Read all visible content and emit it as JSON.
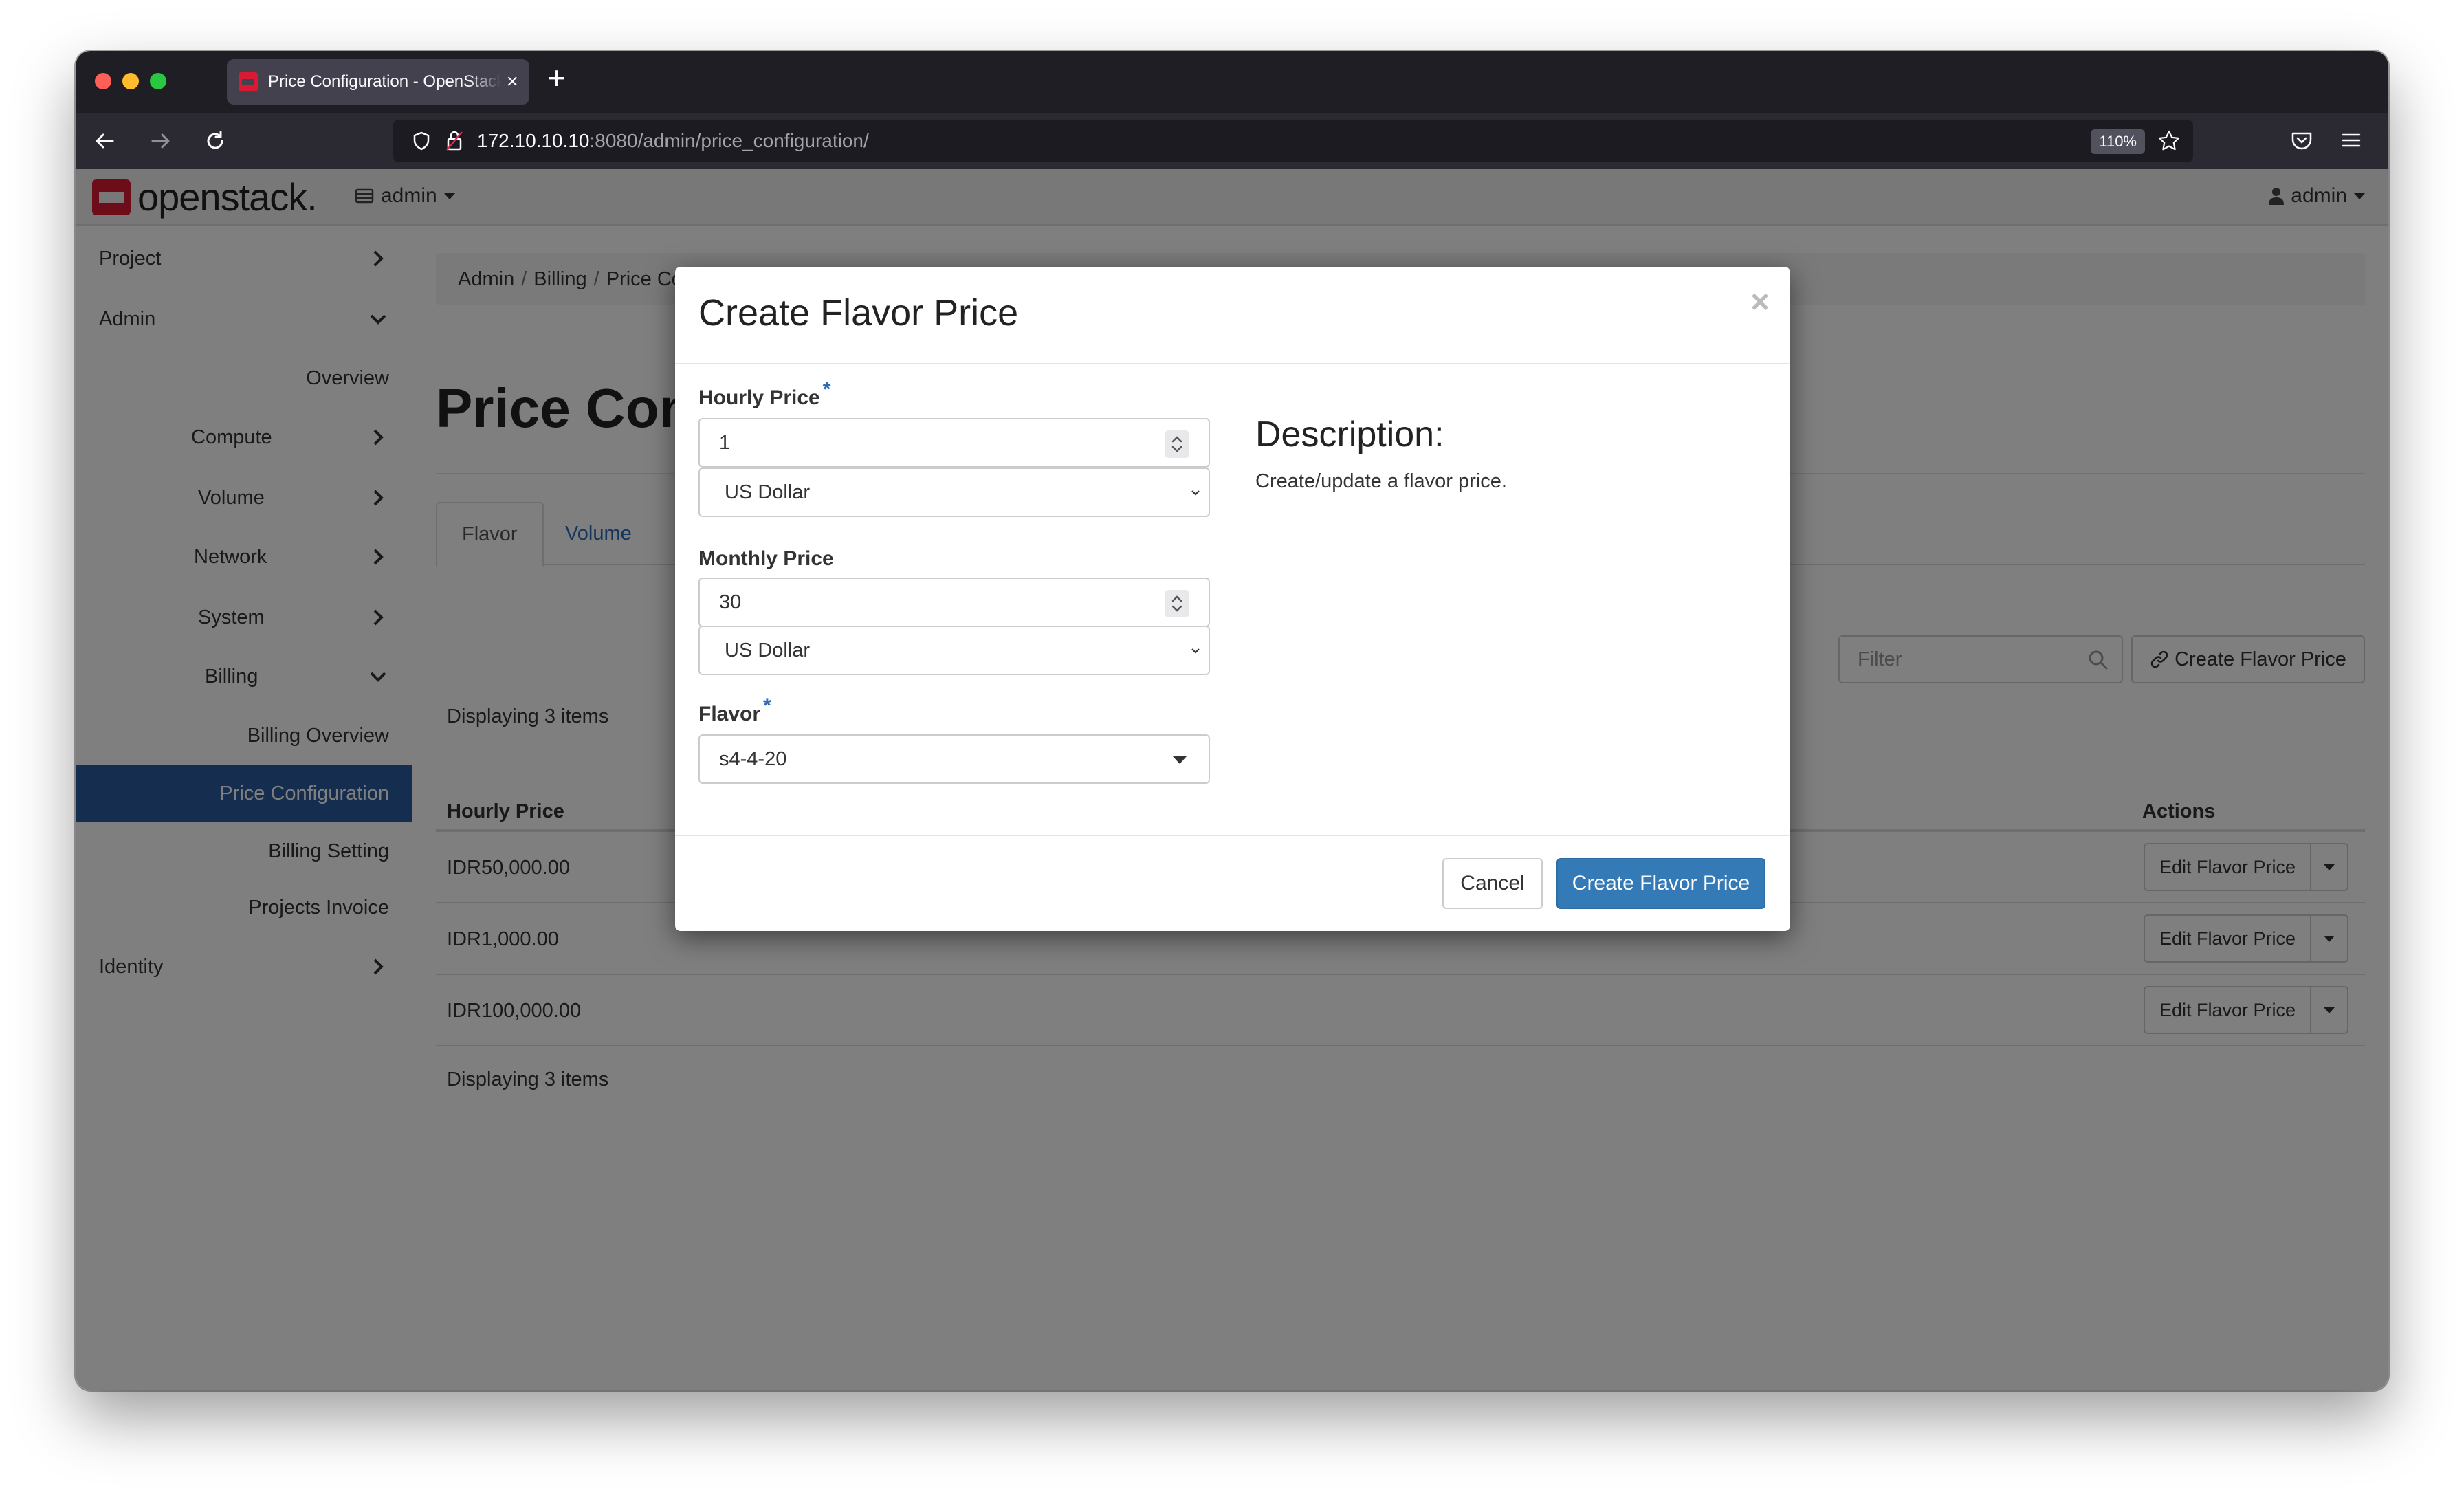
{
  "browser": {
    "tab_title": "Price Configuration - OpenStack",
    "url_host": "172.10.10.10",
    "url_path": ":8080/admin/price_configuration/",
    "zoom": "110%"
  },
  "topnav": {
    "logo_text": "openstack.",
    "project_menu": "admin",
    "user_menu": "admin"
  },
  "sidebar": {
    "items": [
      {
        "label": "Project"
      },
      {
        "label": "Admin"
      },
      {
        "label": "Overview"
      },
      {
        "label": "Compute"
      },
      {
        "label": "Volume"
      },
      {
        "label": "Network"
      },
      {
        "label": "System"
      },
      {
        "label": "Billing"
      },
      {
        "label": "Billing Overview"
      },
      {
        "label": "Price Configuration"
      },
      {
        "label": "Billing Setting"
      },
      {
        "label": "Projects Invoice"
      },
      {
        "label": "Identity"
      }
    ]
  },
  "content": {
    "breadcrumb": [
      "Admin",
      "Billing",
      "Price Configuration"
    ],
    "page_title": "Price Configuration",
    "tabs": [
      "Flavor",
      "Volume"
    ],
    "filter_placeholder": "Filter",
    "create_button": "Create Flavor Price",
    "display_count": "Displaying 3 items",
    "columns": {
      "hourly": "Hourly Price",
      "actions": "Actions"
    },
    "rows": [
      {
        "hourly": "IDR50,000.00",
        "action": "Edit Flavor Price"
      },
      {
        "hourly": "IDR1,000.00",
        "action": "Edit Flavor Price"
      },
      {
        "hourly": "IDR100,000.00",
        "action": "Edit Flavor Price"
      }
    ]
  },
  "modal": {
    "title": "Create Flavor Price",
    "hourly_label": "Hourly Price",
    "hourly_value": "1",
    "hourly_currency": "US Dollar",
    "monthly_label": "Monthly Price",
    "monthly_value": "30",
    "monthly_currency": "US Dollar",
    "flavor_label": "Flavor",
    "flavor_value": "s4-4-20",
    "required_mark": "*",
    "description_title": "Description:",
    "description_text": "Create/update a flavor price.",
    "cancel_label": "Cancel",
    "submit_label": "Create Flavor Price"
  },
  "colors": {
    "primary": "#337ab7",
    "sidebar_active": "#2a5d9f",
    "logo_red": "#da1a32"
  }
}
